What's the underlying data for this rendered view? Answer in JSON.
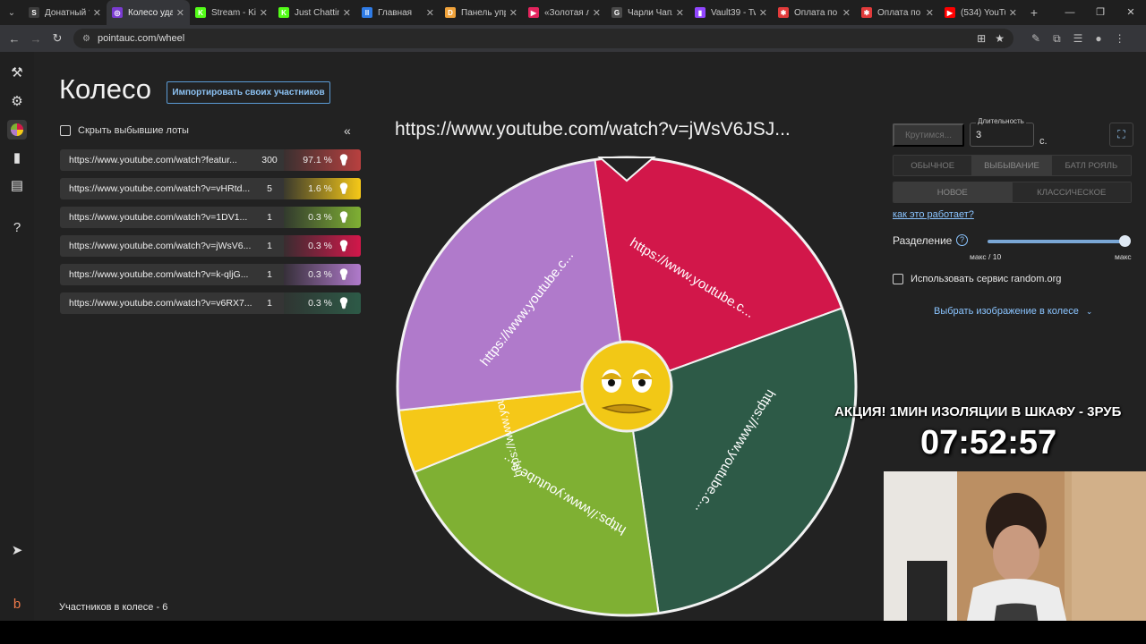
{
  "browser": {
    "tabs": [
      {
        "label": "Донатный т",
        "fav": "S",
        "favColor": "#3d3d3d"
      },
      {
        "label": "Колесо удал",
        "fav": "◎",
        "favColor": "#7a3bd1",
        "active": true
      },
      {
        "label": "Stream - Kic",
        "fav": "K",
        "favColor": "#53fc18"
      },
      {
        "label": "Just Chatting",
        "fav": "K",
        "favColor": "#53fc18"
      },
      {
        "label": "Главная",
        "fav": "ll",
        "favColor": "#2f7be5"
      },
      {
        "label": "Панель упр",
        "fav": "D",
        "favColor": "#f0a23a"
      },
      {
        "label": "«Золотая лі",
        "fav": "▶",
        "favColor": "#e3245d"
      },
      {
        "label": "Чарли Чапл",
        "fav": "G",
        "favColor": "#4a4a4a"
      },
      {
        "label": "Vault39 - Tw",
        "fav": "▮",
        "favColor": "#9146ff"
      },
      {
        "label": "Оплата по С",
        "fav": "✱",
        "favColor": "#e23b3b"
      },
      {
        "label": "Оплата по С",
        "fav": "✱",
        "favColor": "#e23b3b"
      },
      {
        "label": "(534) YouTu",
        "fav": "▶",
        "favColor": "#ff0000"
      }
    ],
    "url": "pointauc.com/wheel"
  },
  "header": {
    "title": "Колесо",
    "import_label": "Импортировать своих участников"
  },
  "list": {
    "hide_label": "Скрыть выбывшие лоты",
    "collapse_glyph": "«",
    "lots": [
      {
        "name": "https://www.youtube.com/watch?featur...",
        "amount": "300",
        "percent": "97.1 %",
        "color": "#b8403f",
        "gradFrom": "#3a3030"
      },
      {
        "name": "https://www.youtube.com/watch?v=vHRtd...",
        "amount": "5",
        "percent": "1.6 %",
        "color": "#f5c818",
        "gradFrom": "#3b3a2c"
      },
      {
        "name": "https://www.youtube.com/watch?v=1DV1...",
        "amount": "1",
        "percent": "0.3 %",
        "color": "#7fb033",
        "gradFrom": "#323a2e"
      },
      {
        "name": "https://www.youtube.com/watch?v=jWsV6...",
        "amount": "1",
        "percent": "0.3 %",
        "color": "#d2174a",
        "gradFrom": "#3a2c30"
      },
      {
        "name": "https://www.youtube.com/watch?v=k-qljG...",
        "amount": "1",
        "percent": "0.3 %",
        "color": "#b07acb",
        "gradFrom": "#37303a"
      },
      {
        "name": "https://www.youtube.com/watch?v=v6RX7...",
        "amount": "1",
        "percent": "0.3 %",
        "color": "#2d5a47",
        "gradFrom": "#2f3532"
      }
    ],
    "participants": "Участников в колесе - 6"
  },
  "wheel": {
    "winner": "https://www.youtube.com/watch?v=jWsV6JSJ...",
    "segment_label": "https://www.youtube.c...",
    "segments": [
      {
        "color": "#d2174a",
        "start": -8,
        "end": 70
      },
      {
        "color": "#2d5a47",
        "start": 70,
        "end": 172
      },
      {
        "color": "#7fb033",
        "start": 172,
        "end": 248
      },
      {
        "color": "#f5c818",
        "start": 248,
        "end": 264
      },
      {
        "color": "#b07acb",
        "start": 264,
        "end": 352
      }
    ]
  },
  "controls": {
    "spin_label": "Крутимся...",
    "duration_label": "Длительность",
    "duration_value": "3",
    "duration_unit": "с.",
    "modes": [
      "ОБЫЧНОЕ",
      "ВЫБЫВАНИЕ",
      "БАТЛ РОЯЛЬ"
    ],
    "active_mode": "ВЫБЫВАНИЕ",
    "variants": [
      "НОВОЕ",
      "КЛАССИЧЕСКОЕ"
    ],
    "how_link": "как это работает?",
    "split_label": "Разделение",
    "split_help": "?",
    "split_min": "макс / 10",
    "split_max": "макс",
    "random_label": "Использовать сервис random.org",
    "image_select": "Выбрать изображение в колесе"
  },
  "overlay": {
    "promo": "АКЦИЯ! 1МИН ИЗОЛЯЦИИ В ШКАФУ - 3РУБ",
    "timer": "07:52:57"
  }
}
